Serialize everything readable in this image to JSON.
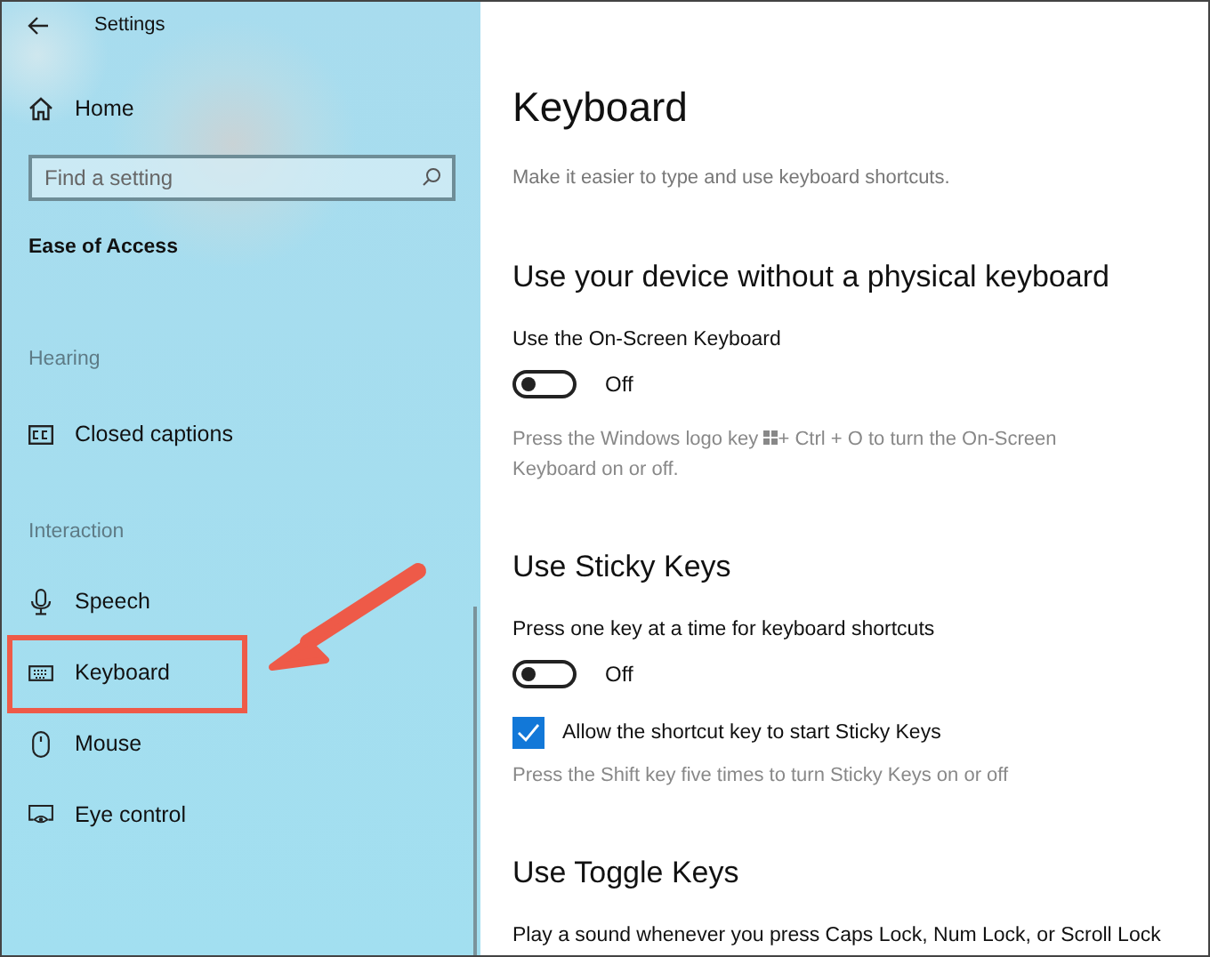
{
  "window": {
    "title": "Settings"
  },
  "sidebar": {
    "home": "Home",
    "search": {
      "placeholder": "Find a setting"
    },
    "category": "Ease of Access",
    "sections": [
      {
        "heading": "Hearing",
        "items": [
          {
            "label": "Closed captions"
          }
        ]
      },
      {
        "heading": "Interaction",
        "items": [
          {
            "label": "Speech"
          },
          {
            "label": "Keyboard"
          },
          {
            "label": "Mouse"
          },
          {
            "label": "Eye control"
          }
        ]
      }
    ]
  },
  "page": {
    "title": "Keyboard",
    "subtitle": "Make it easier to type and use keyboard shortcuts.",
    "sections": [
      {
        "heading": "Use your device without a physical keyboard",
        "label": "Use the On-Screen Keyboard",
        "toggle": {
          "on": false,
          "text": "Off"
        },
        "hint_parts": [
          "Press the Windows logo key",
          "+ Ctrl + O to turn the On-Screen Keyboard on or off."
        ]
      },
      {
        "heading": "Use Sticky Keys",
        "label": "Press one key at a time for keyboard shortcuts",
        "toggle": {
          "on": false,
          "text": "Off"
        },
        "checkbox": {
          "label": "Allow the shortcut key to start Sticky Keys",
          "checked": true
        },
        "hint_parts": [
          "Press the Shift key five times to turn Sticky Keys on or off"
        ]
      },
      {
        "heading": "Use Toggle Keys",
        "label": "Play a sound whenever you press Caps Lock, Num Lock, or Scroll Lock"
      }
    ]
  }
}
